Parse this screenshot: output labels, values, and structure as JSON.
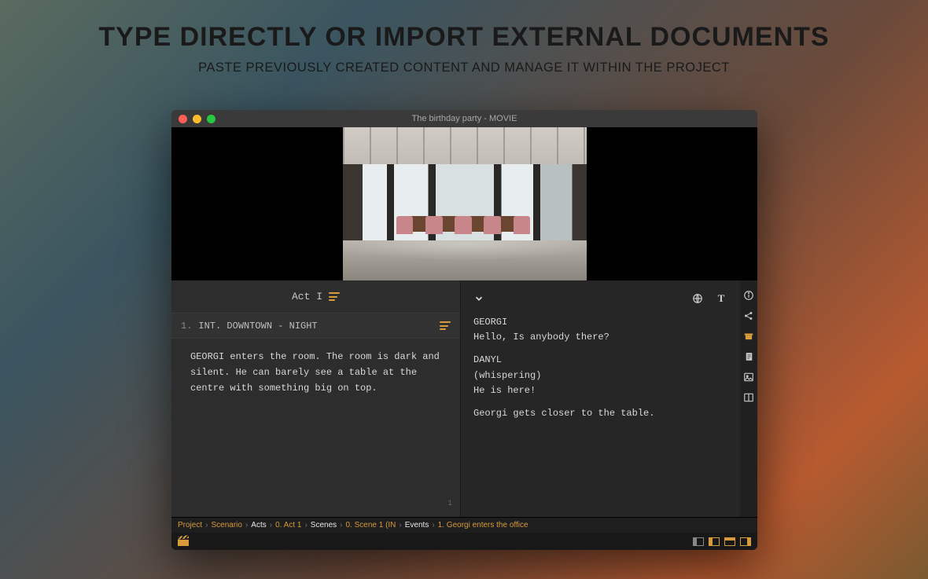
{
  "marketing": {
    "title": "TYPE DIRECTLY OR IMPORT EXTERNAL DOCUMENTS",
    "subtitle": "PASTE PREVIOUSLY CREATED CONTENT AND MANAGE IT WITHIN THE PROJECT"
  },
  "window": {
    "title": "The birthday party - MOVIE"
  },
  "left": {
    "act_label": "Act I",
    "scene_number": "1.",
    "scene_heading": "INT. DOWNTOWN - NIGHT",
    "scene_body": "GEORGI enters the room. The room is dark and silent. He can barely see a table at the centre with something big on top.",
    "page_number": "1"
  },
  "script": {
    "blocks": [
      {
        "character": "GEORGI",
        "dialogue": "Hello, Is anybody there?"
      },
      {
        "character": "DANYL",
        "parenthetical": "(whispering)",
        "dialogue": "He is here!"
      }
    ],
    "action": "Georgi gets closer to the table.",
    "tool_text_label": "T"
  },
  "breadcrumb": {
    "items": [
      "Project",
      "Scenario",
      "Acts",
      "0. Act 1",
      "Scenes",
      "0. Scene 1 (IN",
      "Events",
      "1. Georgi enters the office"
    ],
    "strong_indices": [
      2,
      4,
      6
    ]
  },
  "icons": {
    "globe": "globe-icon",
    "text": "text-tool-icon",
    "info": "info-icon",
    "share": "share-icon",
    "archive": "archive-icon",
    "doc": "document-icon",
    "image": "image-icon",
    "split": "split-icon"
  },
  "colors": {
    "accent": "#d89a3a",
    "bg_dark": "#2a2a2a"
  }
}
